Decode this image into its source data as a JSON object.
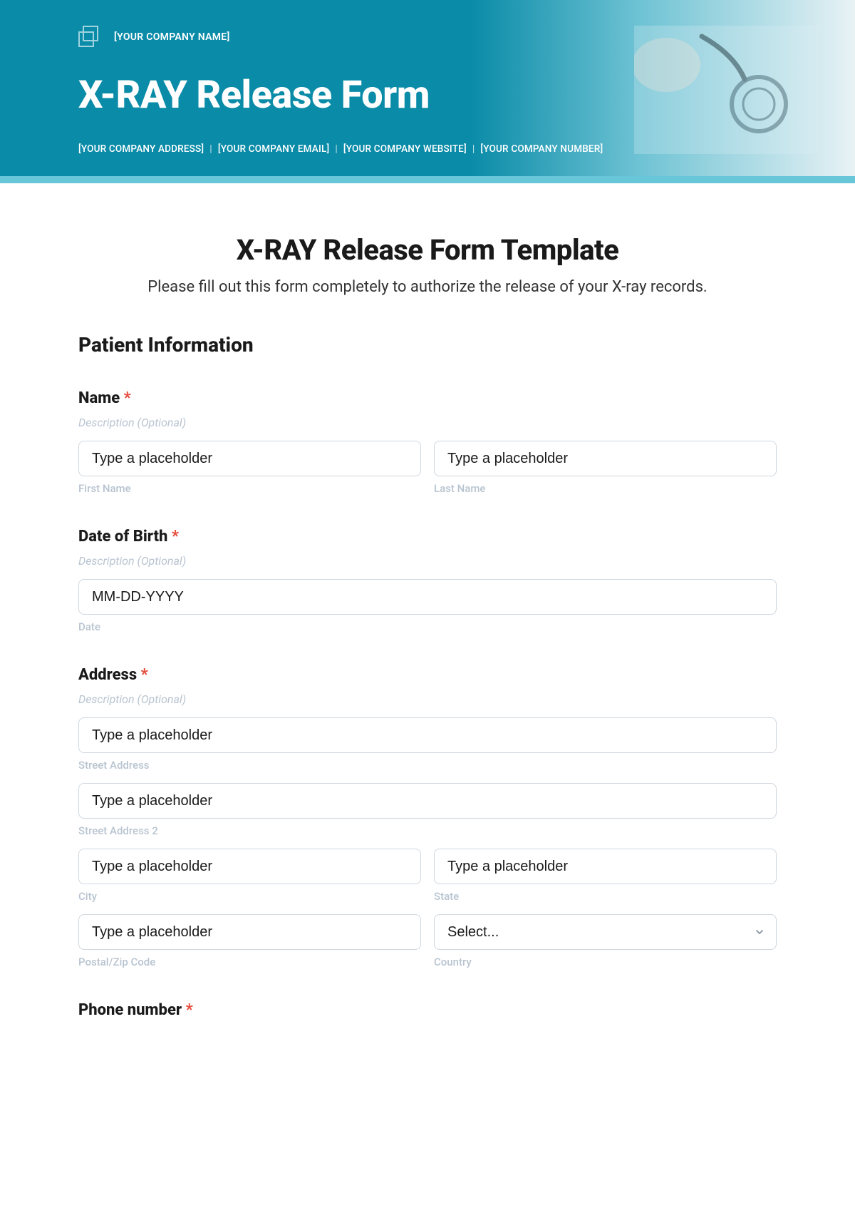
{
  "hero": {
    "company_name": "[YOUR COMPANY NAME]",
    "title": "X-RAY Release Form",
    "address": "[YOUR COMPANY ADDRESS]",
    "email": "[YOUR COMPANY EMAIL]",
    "website": "[YOUR COMPANY WEBSITE]",
    "number": "[YOUR COMPANY NUMBER]"
  },
  "form": {
    "title": "X-RAY Release Form Template",
    "subtitle": "Please fill out this form completely to authorize the release of your X-ray records.",
    "section_patient": "Patient Information",
    "desc_optional": "Description (Optional)",
    "ph_text": "Type a placeholder",
    "name": {
      "label": "Name",
      "first_sub": "First Name",
      "last_sub": "Last Name"
    },
    "dob": {
      "label": "Date of Birth",
      "ph": "MM-DD-YYYY",
      "sub": "Date"
    },
    "address": {
      "label": "Address",
      "street_sub": "Street Address",
      "street2_sub": "Street Address 2",
      "city_sub": "City",
      "state_sub": "State",
      "postal_sub": "Postal/Zip Code",
      "country_sub": "Country",
      "country_ph": "Select..."
    },
    "phone": {
      "label": "Phone number"
    }
  }
}
